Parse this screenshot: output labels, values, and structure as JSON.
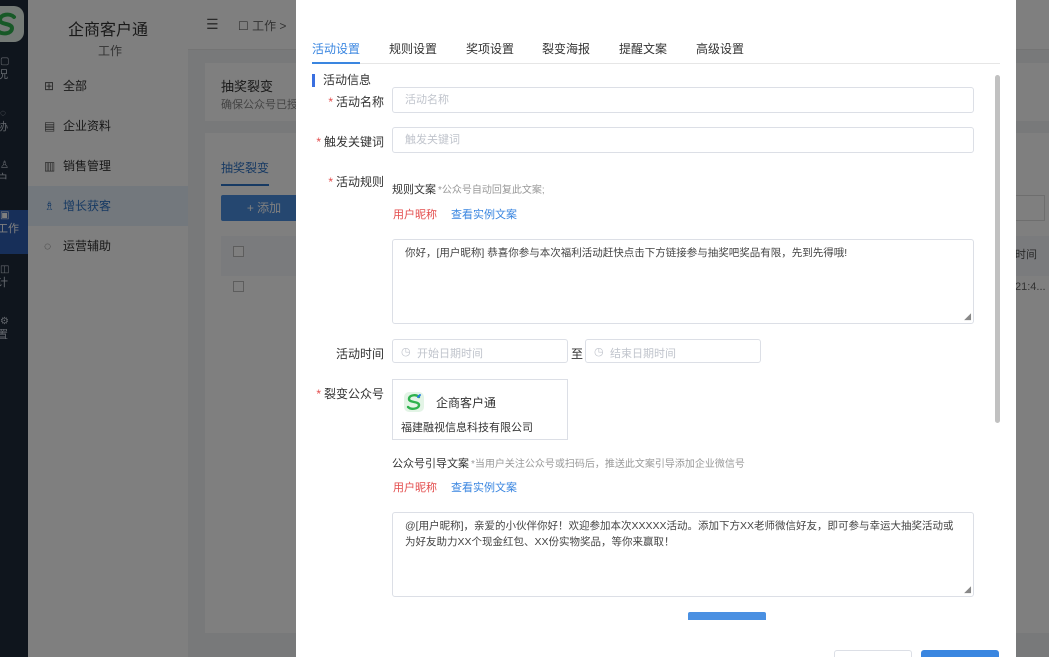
{
  "rail": {
    "items": [
      {
        "icon": "▢",
        "label": "况"
      },
      {
        "icon": "◌",
        "label": "协"
      },
      {
        "icon": "♙",
        "label": "户"
      },
      {
        "icon": "▣",
        "label": "工作"
      },
      {
        "icon": "◫",
        "label": "计"
      },
      {
        "icon": "⚙",
        "label": "置"
      }
    ]
  },
  "sidebar": {
    "app_name": "企商客户通",
    "app_sub": "工作",
    "items": [
      {
        "icon": "⊞",
        "label": "全部"
      },
      {
        "icon": "▤",
        "label": "企业资料"
      },
      {
        "icon": "▥",
        "label": "销售管理"
      },
      {
        "icon": "♗",
        "label": "增长获客"
      },
      {
        "icon": "◌",
        "label": "运营辅助"
      }
    ]
  },
  "topbar": {
    "menu_icon": "☰",
    "breadcrumb": "☐ 工作 >"
  },
  "background": {
    "card_title": "抽奖裂变",
    "card_desc": "确保公众号已授权",
    "tab": "抽奖裂变",
    "add_button": "+ 添加",
    "col_header": "时间",
    "cell_time": "21:4..."
  },
  "dialog": {
    "tabs": [
      "活动设置",
      "规则设置",
      "奖项设置",
      "裂变海报",
      "提醒文案",
      "高级设置"
    ],
    "active_tab": 0,
    "section_title": "活动信息",
    "fields": {
      "name": {
        "label": "活动名称",
        "placeholder": "活动名称"
      },
      "keyword": {
        "label": "触发关键词",
        "placeholder": "触发关键词"
      },
      "rules": {
        "label": "活动规则",
        "text_label": "规则文案",
        "hint": "*公众号自动回复此文案;",
        "user_nick": "用户昵称",
        "sample_link": "查看实例文案",
        "content": "你好，[用户昵称] 恭喜你参与本次福利活动赶快点击下方链接参与抽奖吧奖品有限，先到先得哦!"
      },
      "time": {
        "label": "活动时间",
        "start_placeholder": "开始日期时间",
        "separator": "至",
        "end_placeholder": "结束日期时间",
        "clock_icon": "◷"
      },
      "account": {
        "label": "裂变公众号",
        "name": "企商客户通",
        "company": "福建融视信息科技有限公司"
      },
      "guide": {
        "text_label": "公众号引导文案",
        "hint": "*当用户关注公众号或扫码后，推送此文案引导添加企业微信号",
        "user_nick": "用户昵称",
        "sample_link": "查看实例文案",
        "content": "@[用户昵称]，亲爱的小伙伴你好！欢迎参加本次XXXXX活动。添加下方XX老师微信好友，即可参与幸运大抽奖活动或为好友助力XX个现金红包、XX份实物奖品，等你来赢取！"
      }
    },
    "colors": {
      "primary": "#3a86e0",
      "required": "#e34d4d",
      "section_bar": "#3a6fe0"
    }
  }
}
